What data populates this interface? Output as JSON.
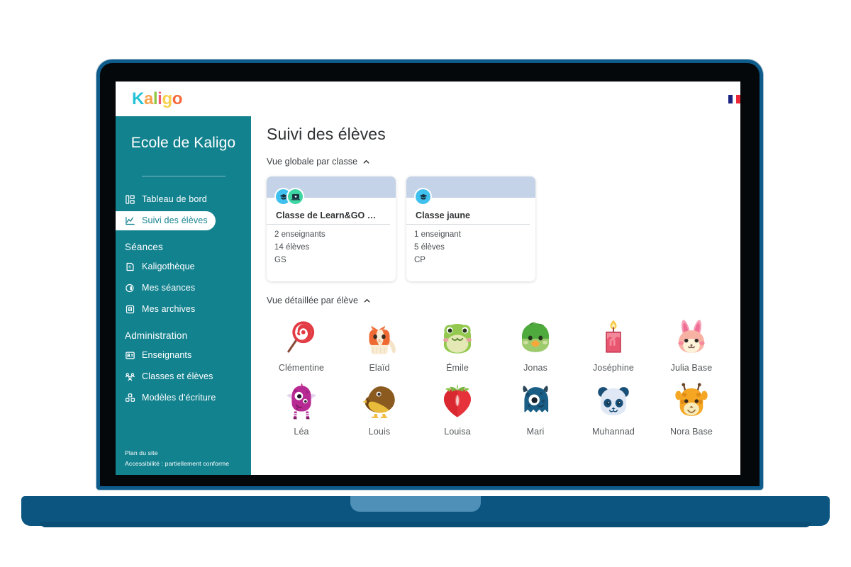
{
  "header": {
    "brand": {
      "letters": [
        "K",
        "a",
        "l",
        "i",
        "g",
        "o"
      ]
    },
    "language_flag": "france-flag-icon",
    "user_avatar_label": "?"
  },
  "sidebar": {
    "school_name": "Ecole de Kaligo",
    "items": [
      {
        "label": "Tableau de bord",
        "icon": "dashboard-icon",
        "type": "link",
        "active": false
      },
      {
        "label": "Suivi des élèves",
        "icon": "chart-line-icon",
        "type": "link",
        "active": true
      },
      {
        "label": "Séances",
        "type": "section"
      },
      {
        "label": "Kaligothèque",
        "icon": "library-icon",
        "type": "link",
        "active": false
      },
      {
        "label": "Mes séances",
        "icon": "session-icon",
        "type": "link",
        "active": false
      },
      {
        "label": "Mes archives",
        "icon": "archive-icon",
        "type": "link",
        "active": false
      },
      {
        "label": "Administration",
        "type": "section"
      },
      {
        "label": "Enseignants",
        "icon": "id-card-icon",
        "type": "link",
        "active": false
      },
      {
        "label": "Classes et élèves",
        "icon": "people-icon",
        "type": "link",
        "active": false
      },
      {
        "label": "Modèles d'écriture",
        "icon": "blocks-icon",
        "type": "link",
        "active": false
      }
    ],
    "footer": {
      "site_map": "Plan du site",
      "accessibility": "Accessibilité : partiellement conforme"
    }
  },
  "main": {
    "page_title": "Suivi des élèves",
    "sections": {
      "global": {
        "label": "Vue globale par classe",
        "toggle_icon": "chevron-up-icon",
        "expanded": true
      },
      "detail": {
        "label": "Vue détaillée par élève",
        "toggle_icon": "chevron-up-icon",
        "expanded": true
      }
    },
    "class_cards": [
      {
        "title": "Classe de Learn&GO KA...",
        "badges": [
          "graduation-cap-icon",
          "laptop-screen-icon"
        ],
        "teachers": "2 enseignants",
        "students": "14 élèves",
        "level": "GS"
      },
      {
        "title": "Classe jaune",
        "badges": [
          "graduation-cap-icon"
        ],
        "teachers": "1 enseignant",
        "students": "5 élèves",
        "level": "CP"
      }
    ],
    "students": [
      {
        "name": "Clémentine",
        "avatar": "lollipop-avatar"
      },
      {
        "name": "Elaïd",
        "avatar": "cat-avatar"
      },
      {
        "name": "Émile",
        "avatar": "frog-avatar"
      },
      {
        "name": "Jonas",
        "avatar": "green-bird-avatar"
      },
      {
        "name": "Joséphine",
        "avatar": "candle-avatar"
      },
      {
        "name": "Julia Base",
        "avatar": "pink-bunny-avatar"
      },
      {
        "name": "Léa",
        "avatar": "purple-monster-avatar"
      },
      {
        "name": "Louis",
        "avatar": "brown-bird-avatar"
      },
      {
        "name": "Louisa",
        "avatar": "strawberry-avatar"
      },
      {
        "name": "Mari",
        "avatar": "blue-monster-avatar"
      },
      {
        "name": "Muhannad",
        "avatar": "panda-avatar"
      },
      {
        "name": "Nora Base",
        "avatar": "giraffe-avatar"
      }
    ]
  },
  "colors": {
    "sidebar_teal": "#13828f",
    "card_banner": "#c5d3e8",
    "laptop_bezel": "#0d5c8c",
    "laptop_base": "#0b5580",
    "trackpad": "#4e90b7"
  }
}
